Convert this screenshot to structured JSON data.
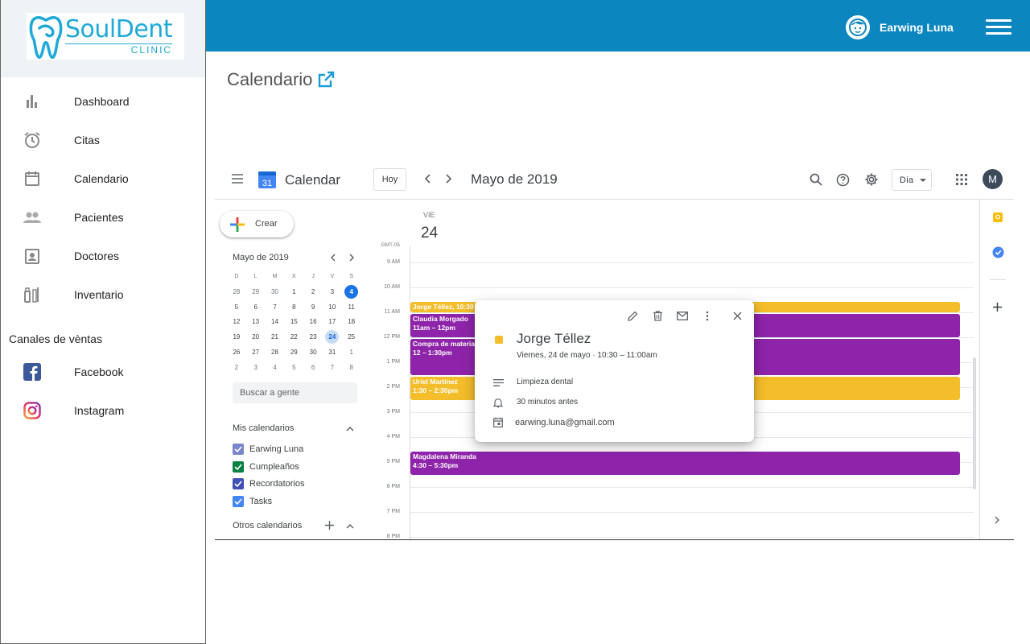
{
  "app": {
    "brand_name": "SoulDent",
    "brand_sub": "CLINIC",
    "user_name": "Earwing Luna",
    "page_title": "Calendario"
  },
  "nav": [
    {
      "label": "Dashboard",
      "icon": "bar-chart-icon"
    },
    {
      "label": "Citas",
      "icon": "alarm-clock-icon"
    },
    {
      "label": "Calendario",
      "icon": "calendar-icon"
    },
    {
      "label": "Pacientes",
      "icon": "people-icon"
    },
    {
      "label": "Doctores",
      "icon": "doctor-badge-icon"
    },
    {
      "label": "Inventario",
      "icon": "dental-tools-icon"
    }
  ],
  "sales": {
    "title": "Canales de vèntas",
    "items": [
      {
        "label": "Facebook",
        "icon": "facebook-icon"
      },
      {
        "label": "Instagram",
        "icon": "instagram-icon"
      }
    ]
  },
  "gcal": {
    "app_name": "Calendar",
    "logo_day": "31",
    "today": "Hoy",
    "month": "Mayo de 2019",
    "view": "Día",
    "account_initial": "M",
    "create": "Crear",
    "mini": {
      "title": "Mayo de 2019",
      "dow": [
        "D",
        "L",
        "M",
        "X",
        "J",
        "V",
        "S"
      ],
      "weeks": [
        [
          "28",
          "29",
          "30",
          "1",
          "2",
          "3",
          "4"
        ],
        [
          "5",
          "6",
          "7",
          "8",
          "9",
          "10",
          "11"
        ],
        [
          "12",
          "13",
          "14",
          "15",
          "16",
          "17",
          "18"
        ],
        [
          "19",
          "20",
          "21",
          "22",
          "23",
          "24",
          "25"
        ],
        [
          "26",
          "27",
          "28",
          "29",
          "30",
          "31",
          "1"
        ],
        [
          "2",
          "3",
          "4",
          "5",
          "6",
          "7",
          "8"
        ]
      ]
    },
    "people_search": "Buscar a gente",
    "my_calendars_title": "Mis calendarios",
    "my_calendars": [
      {
        "name": "Earwing Luna",
        "color": "#7986cb"
      },
      {
        "name": "Cumpleaños",
        "color": "#0b8043"
      },
      {
        "name": "Recordatorios",
        "color": "#3f51b5"
      },
      {
        "name": "Tasks",
        "color": "#4285f4"
      }
    ],
    "other_calendars_title": "Otros calendarios",
    "day": {
      "dow": "VIE",
      "num": "24",
      "tz": "GMT-05"
    },
    "hours": [
      "9 AM",
      "10 AM",
      "11 AM",
      "12 PM",
      "1 PM",
      "2 PM",
      "3 PM",
      "4 PM",
      "5 PM",
      "6 PM",
      "7 PM",
      "8 PM"
    ],
    "events": [
      {
        "title": "Jorge Téllez",
        "time": "10:30",
        "color": "yellow",
        "start": 10.5,
        "end": 11,
        "inline": true
      },
      {
        "title": "Claudia Morgado",
        "time": "11am – 12pm",
        "color": "purple",
        "start": 11,
        "end": 12
      },
      {
        "title": "Compra de materia",
        "time": "12 – 1:30pm",
        "color": "purple",
        "start": 12,
        "end": 13.5
      },
      {
        "title": "Uriel Martínez",
        "time": "1:30 – 2:30pm",
        "color": "yellow",
        "start": 13.5,
        "end": 14.5
      },
      {
        "title": "Magdalena Miranda",
        "time": "4:30 – 5:30pm",
        "color": "purple",
        "start": 16.5,
        "end": 17.5
      }
    ],
    "popup": {
      "title": "Jorge Téllez",
      "when": "Viernes, 24 de mayo  ·  10:30 – 11:00am",
      "description": "Limpieza dental",
      "reminder": "30 minutos antes",
      "calendar": "earwing.luna@gmail.com"
    }
  },
  "colors": {
    "topbar": "#0b86bf",
    "event_yellow": "#f4be2b",
    "event_purple": "#8e24aa",
    "today_blue": "#1a73e8"
  }
}
